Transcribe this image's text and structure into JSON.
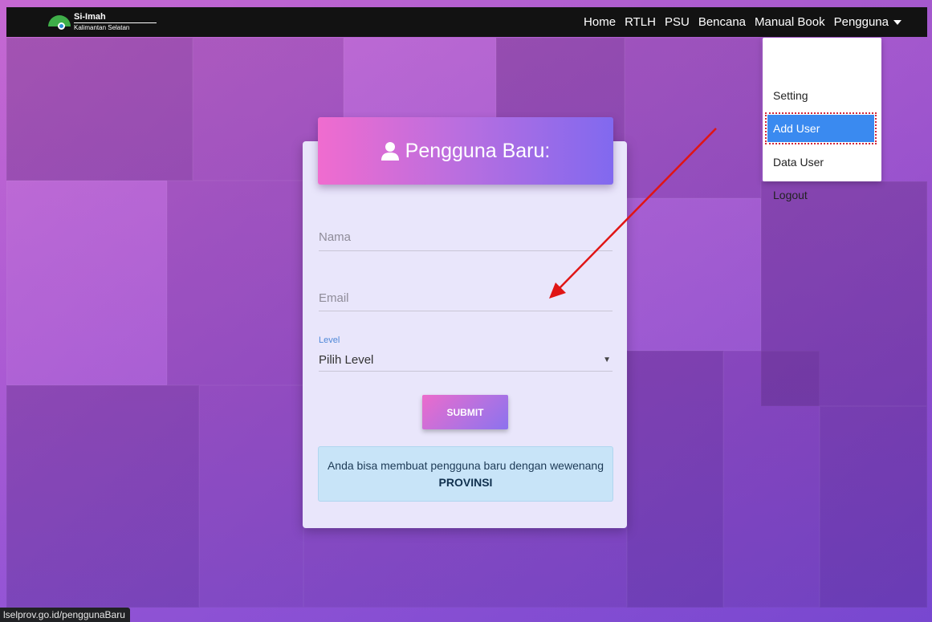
{
  "brand": {
    "name": "Si-Imah",
    "subtitle": "Kalimantan Selatan"
  },
  "nav": {
    "items": [
      {
        "label": "Home"
      },
      {
        "label": "RTLH"
      },
      {
        "label": "PSU"
      },
      {
        "label": "Bencana"
      },
      {
        "label": "Manual Book"
      },
      {
        "label": "Pengguna"
      }
    ]
  },
  "dropdown": {
    "items": [
      {
        "label": "Setting"
      },
      {
        "label": "Add User"
      },
      {
        "label": "Data User"
      },
      {
        "label": "Logout"
      }
    ],
    "active": "Add User"
  },
  "form": {
    "title": "Pengguna Baru:",
    "nama_placeholder": "Nama",
    "email_placeholder": "Email",
    "level_label": "Level",
    "level_selected": "Pilih Level",
    "submit_label": "SUBMIT",
    "info_text": "Anda bisa membuat pengguna baru dengan wewenang",
    "info_bold": "PROVINSI"
  },
  "status_bar": {
    "url": "lselprov.go.id/penggunaBaru"
  },
  "colors": {
    "navbar": "#121212",
    "header_gradient_start": "#f06ccf",
    "header_gradient_end": "#8169ef",
    "active_item": "#3a8af0",
    "annotation_arrow": "#e01515"
  }
}
